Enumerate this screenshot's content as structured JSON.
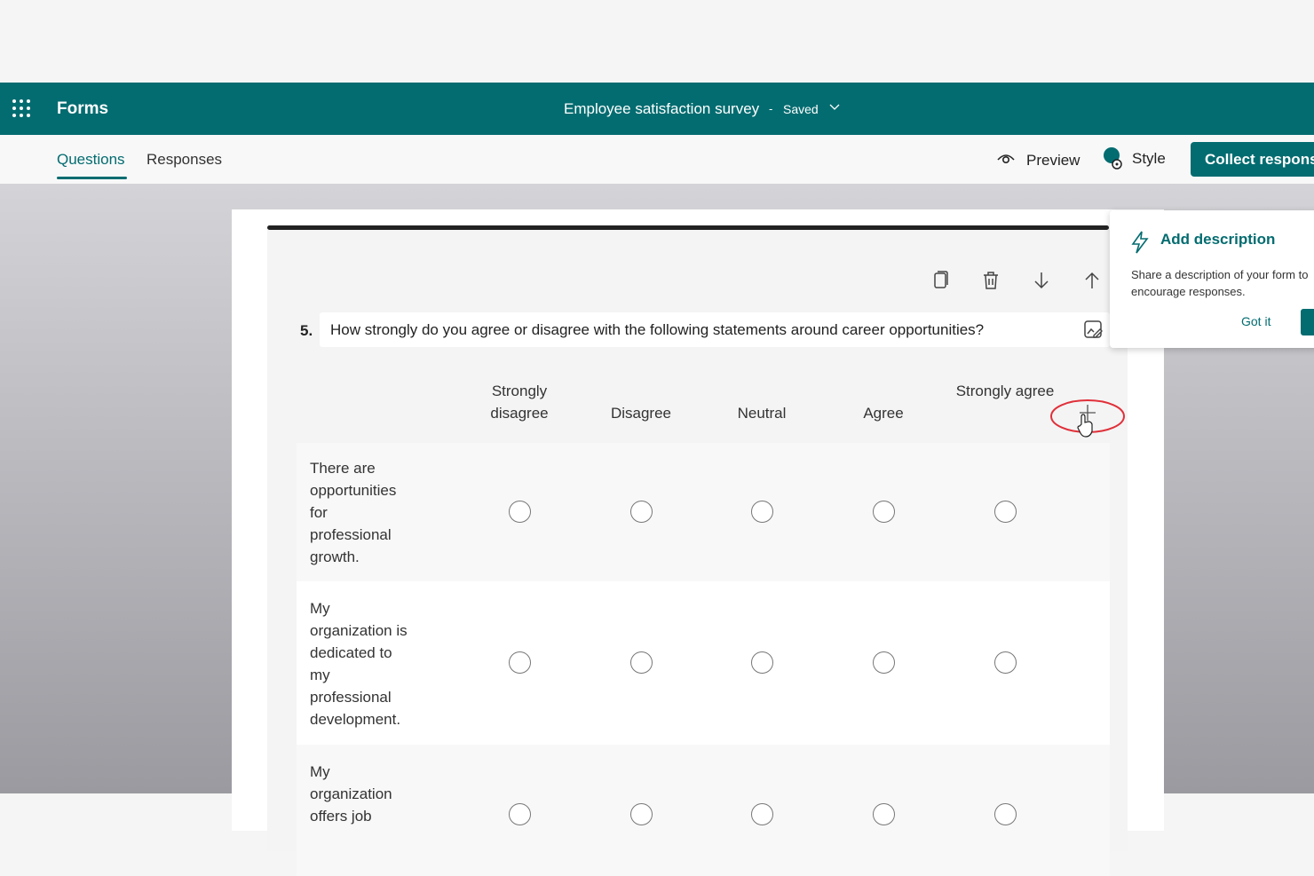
{
  "app": {
    "name": "Forms"
  },
  "form": {
    "title": "Employee satisfaction survey",
    "separator": "-",
    "status": "Saved"
  },
  "tabs": [
    {
      "label": "Questions",
      "active": true
    },
    {
      "label": "Responses",
      "active": false
    }
  ],
  "actions": {
    "preview": "Preview",
    "style": "Style",
    "collect": "Collect responses"
  },
  "question": {
    "number": "5.",
    "text": "How strongly do you agree or disagree with the following statements around career opportunities?",
    "options": [
      "Strongly disagree",
      "Disagree",
      "Neutral",
      "Agree",
      "Strongly agree"
    ],
    "statements": [
      "There are opportunities for professional growth.",
      "My organization is dedicated to my professional development.",
      "My organization offers job"
    ]
  },
  "popup": {
    "title": "Add description",
    "text_line1": "Share a description of your form to",
    "text_line2": "encourage responses.",
    "got_it": "Got it"
  },
  "colors": {
    "brand": "#036c70",
    "highlight_ring": "#e0303a"
  }
}
